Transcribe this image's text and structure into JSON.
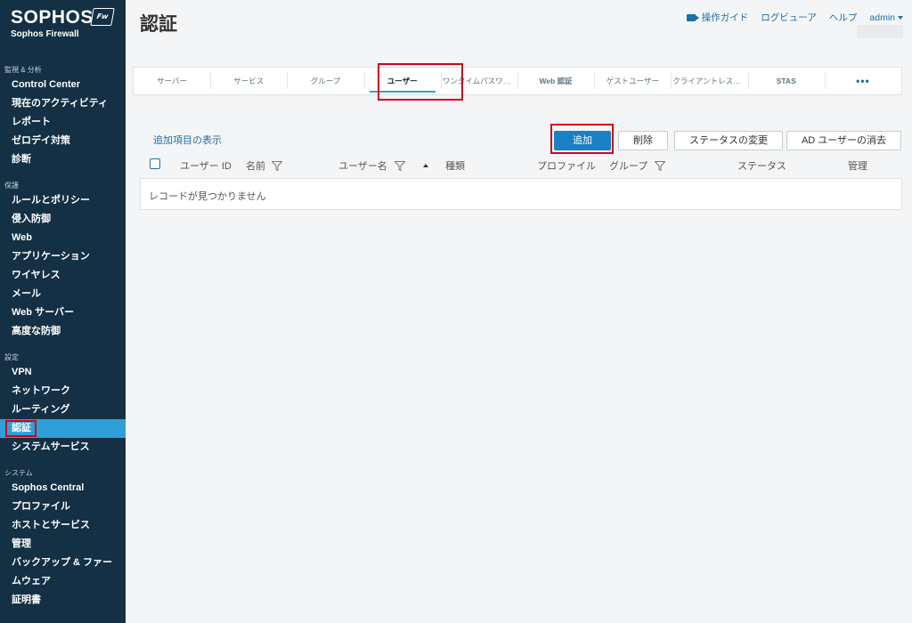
{
  "sidebar": {
    "brand": "SOPHOS",
    "brand_badge": "Fw",
    "product": "Sophos Firewall",
    "sections": [
      {
        "title": "監視 & 分析",
        "items": [
          "Control Center",
          "現在のアクティビティ",
          "レポート",
          "ゼロデイ対策",
          "診断"
        ]
      },
      {
        "title": "保護",
        "items": [
          "ルールとポリシー",
          "侵入防御",
          "Web",
          "アプリケーション",
          "ワイヤレス",
          "メール",
          "Web サーバー",
          "高度な防御"
        ]
      },
      {
        "title": "設定",
        "items": [
          "VPN",
          "ネットワーク",
          "ルーティング",
          "認証",
          "システムサービス"
        ]
      },
      {
        "title": "システム",
        "items": [
          "Sophos Central",
          "プロファイル",
          "ホストとサービス",
          "管理",
          "バックアップ & ファームウェア",
          "証明書"
        ]
      }
    ],
    "active_item": "認証"
  },
  "header": {
    "title": "認証",
    "guide_label": "操作ガイド",
    "log_viewer_label": "ログビューア",
    "help_label": "ヘルプ",
    "user_label": "admin"
  },
  "tabs": [
    {
      "label": "サーバー",
      "active": false
    },
    {
      "label": "サービス",
      "active": false
    },
    {
      "label": "グループ",
      "active": false
    },
    {
      "label": "ユーザー",
      "active": true
    },
    {
      "label": "ワンタイムパスワー…",
      "active": false
    },
    {
      "label": "Web 認証",
      "active": false
    },
    {
      "label": "ゲストユーザー",
      "active": false
    },
    {
      "label": "クライアントレスユー…",
      "active": false
    },
    {
      "label": "STAS",
      "active": false
    },
    {
      "label": "•••",
      "active": false
    }
  ],
  "toolbar": {
    "show_more_label": "追加項目の表示",
    "add_label": "追加",
    "delete_label": "削除",
    "change_status_label": "ステータスの変更",
    "ad_purge_label": "AD ユーザーの消去"
  },
  "table": {
    "columns": {
      "user_id": "ユーザー ID",
      "name": "名前",
      "username": "ユーザー名",
      "type": "種類",
      "profile": "プロファイル",
      "group": "グループ",
      "status": "ステータス",
      "manage": "管理"
    },
    "empty_message": "レコードが見つかりません"
  },
  "colors": {
    "sidebar_bg": "#133044",
    "accent": "#2e9fd8",
    "primary_button": "#1a82c4",
    "highlight": "#d0021b"
  }
}
